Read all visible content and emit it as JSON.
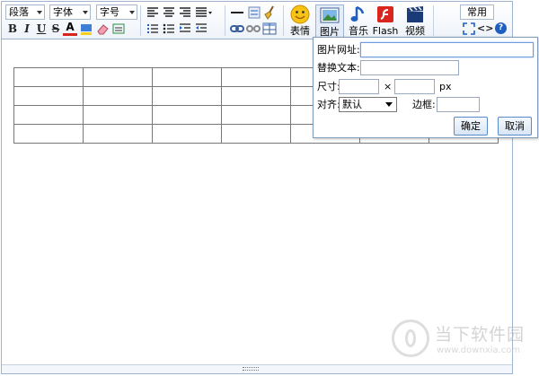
{
  "toolbar": {
    "paragraph_label": "段落",
    "font_label": "字体",
    "size_label": "字号",
    "emotion_label": "表情",
    "image_label": "图片",
    "music_label": "音乐",
    "flash_label": "Flash",
    "video_label": "视频",
    "common_label": "常用",
    "bold_label": "B",
    "italic_label": "I",
    "underline_label": "U",
    "strike_label": "S",
    "fontcolor_label": "A",
    "code_label": "<>",
    "help_label": "?"
  },
  "image_dialog": {
    "url_label": "图片网址:",
    "url_value": "",
    "alt_label": "替换文本:",
    "alt_value": "",
    "size_label": "尺寸:",
    "width_value": "",
    "times_sign": "×",
    "height_value": "",
    "unit_label": "px",
    "align_label": "对齐:",
    "align_selected": "默认",
    "border_label": "边框:",
    "border_value": "",
    "ok_label": "确定",
    "cancel_label": "取消"
  },
  "table": {
    "rows": 4,
    "cols": 7
  },
  "watermark": {
    "name": "当下软件园",
    "url": "www.downxia.com"
  },
  "colors": {
    "border": "#9fb3cf",
    "button_border": "#5a88c8",
    "accent_red": "#d8261f",
    "accent_blue": "#1f5fbf"
  }
}
